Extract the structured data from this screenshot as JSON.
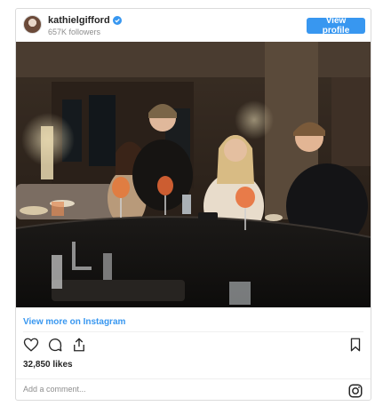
{
  "header": {
    "username": "kathielgifford",
    "followers": "657K followers",
    "view_profile_label": "View profile"
  },
  "post": {
    "view_more_label": "View more on Instagram",
    "likes": "32,850 likes",
    "comment_placeholder": "Add a comment..."
  },
  "colors": {
    "accent": "#3897f0",
    "text": "#262626",
    "muted": "#8e8e8e",
    "border": "#dbdbdb"
  },
  "icons": {
    "like": "heart-icon",
    "comment": "comment-icon",
    "share": "share-icon",
    "save": "bookmark-icon",
    "brand": "instagram-icon",
    "verified": "verified-badge-icon"
  }
}
